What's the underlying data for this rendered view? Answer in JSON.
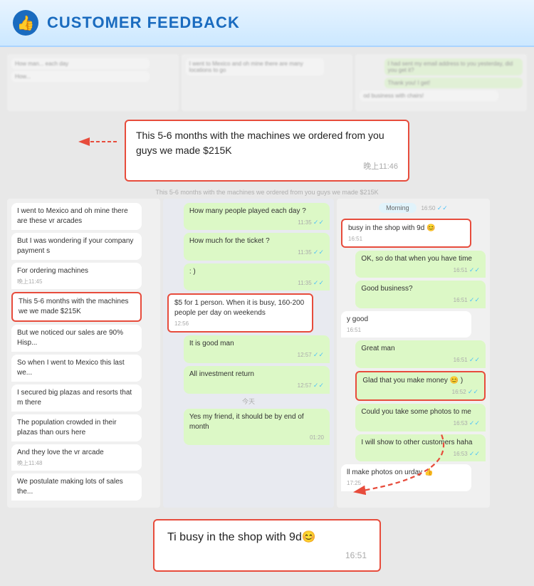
{
  "header": {
    "title": "CUSTOMER FEEDBACK",
    "icon_alt": "thumbs-up-icon"
  },
  "top_highlight": {
    "text": "This 5-6 months with the machines we ordered from you guys we made $215K",
    "time": "晚上11:46"
  },
  "left_panel": {
    "messages": [
      {
        "text": "I went to Mexico and oh mine there are these vr arcades",
        "side": "left"
      },
      {
        "text": "But I was wondering if your company payment s",
        "side": "left"
      },
      {
        "text": "For ordering machines",
        "side": "left",
        "time": "晚上11:45"
      },
      {
        "text": "This 5-6 months with the machines we we made $215K",
        "side": "left",
        "highlight": true
      },
      {
        "text": "But we noticed our sales are 90% Hisp...",
        "side": "left"
      },
      {
        "text": "So when I went to Mexico this last we...",
        "side": "left"
      },
      {
        "text": "I secured big plazas and resorts that m there",
        "side": "left"
      },
      {
        "text": "The population crowded in their plazas than ours here",
        "side": "left"
      },
      {
        "text": "And they love the vr arcade",
        "side": "left",
        "time": "晚上11:48"
      },
      {
        "text": "We postulate making lots of sales the...",
        "side": "left"
      }
    ]
  },
  "mid_panel": {
    "messages": [
      {
        "text": "How many people played each day ?",
        "side": "right",
        "time": "11:35"
      },
      {
        "text": "How much for the ticket ?",
        "side": "right",
        "time": "11:35"
      },
      {
        "text": ": )",
        "side": "right",
        "time": "11:35"
      },
      {
        "text": "$5 for 1 person. When it is busy, 160-200 people per day on weekends",
        "side": "left",
        "time": "12:56",
        "highlight": true
      },
      {
        "text": "It is good man",
        "side": "right",
        "time": "12:57"
      },
      {
        "text": "All investment return",
        "side": "right",
        "time": "12:57"
      },
      {
        "text_center": "今天"
      },
      {
        "text": "Yes my friend, it should be by end of month",
        "side": "right",
        "time": "01:20"
      }
    ]
  },
  "right_panel": {
    "header_time": "16:50",
    "messages": [
      {
        "text": "Morning",
        "side": "right",
        "time": "16:50"
      },
      {
        "text": "busy in the shop with 9d 😊",
        "side": "left",
        "time": "16:51",
        "highlight": true
      },
      {
        "text": "OK, so do that when you have time",
        "side": "right",
        "time": "16:51"
      },
      {
        "text": "Good business?",
        "side": "right",
        "time": "16:51"
      },
      {
        "text": "y good",
        "side": "left",
        "time": "16:51"
      },
      {
        "text": "Great man",
        "side": "right",
        "time": "16:51"
      },
      {
        "text": "Glad that you make money 😊 )",
        "side": "right",
        "time": "16:52",
        "highlight": true
      },
      {
        "text": "Could you take some photos to me",
        "side": "right",
        "time": "16:53"
      },
      {
        "text": "I will show to other customers haha",
        "side": "right",
        "time": "16:53"
      },
      {
        "text": "ll make photos on urday 👍",
        "side": "left",
        "time": "17:25"
      }
    ]
  },
  "bottom_highlight": {
    "text": "Ti busy in the shop with 9d😊",
    "time": "16:51"
  }
}
